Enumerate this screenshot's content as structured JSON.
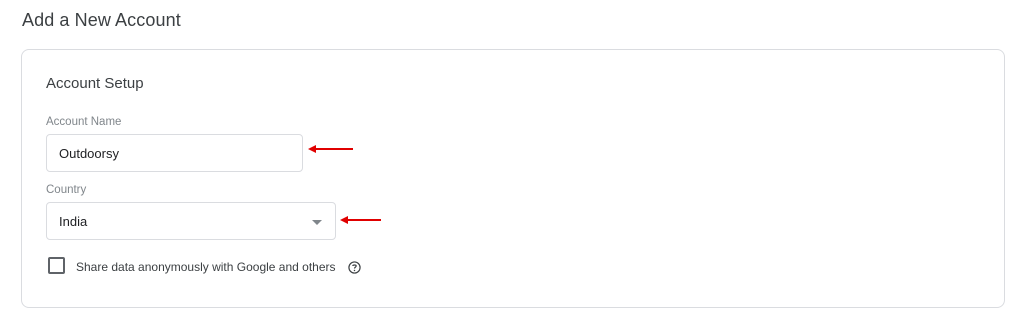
{
  "page": {
    "title": "Add a New Account"
  },
  "account_setup": {
    "title": "Account Setup",
    "account_name": {
      "label": "Account Name",
      "value": "Outdoorsy"
    },
    "country": {
      "label": "Country",
      "selected": "India"
    },
    "share_data": {
      "label": "Share data anonymously with Google and others",
      "checked": false
    }
  },
  "icons": {
    "help": "help-circle-icon",
    "dropdown": "caret-down-icon",
    "annotation": "red-arrow-left-icon"
  },
  "colors": {
    "annotation_arrow": "#e00000",
    "border": "#dadce0",
    "text": "#3c4043"
  }
}
